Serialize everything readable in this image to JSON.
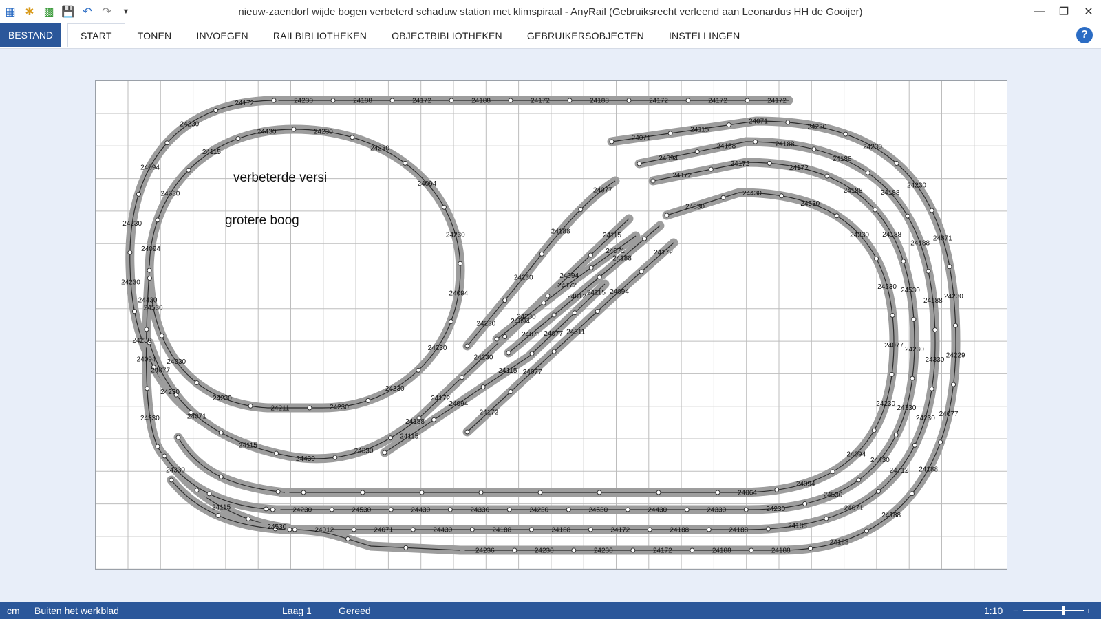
{
  "window": {
    "title": "nieuw-zaendorf wijde bogen verbeterd schaduw station met klimspiraal -  AnyRail (Gebruiksrecht verleend aan Leonardus HH de Gooijer)",
    "minimize_icon": "minimize-icon",
    "restore_icon": "restore-icon",
    "close_icon": "close-icon"
  },
  "quick_access": {
    "icons": [
      "app-logo-icon",
      "new-file-icon",
      "open-file-icon",
      "save-icon",
      "undo-icon",
      "redo-icon",
      "customize-dropdown-icon"
    ]
  },
  "ribbon": {
    "file_tab": "BESTAND",
    "tabs": [
      "START",
      "TONEN",
      "INVOEGEN",
      "RAILBIBLIOTHEKEN",
      "OBJECTBIBLIOTHEKEN",
      "GEBRUIKERSOBJECTEN",
      "INSTELLINGEN"
    ],
    "active_tab": "START",
    "help_label": "?"
  },
  "layout": {
    "annotations": [
      "verbeterde versi",
      "grotere boog"
    ],
    "track_labels": [
      "24230",
      "24188",
      "24172",
      "24188",
      "24172",
      "24188",
      "24172",
      "24172",
      "24172",
      "24172",
      "24230",
      "24094",
      "24230",
      "24230",
      "24230",
      "24230",
      "24230",
      "24230",
      "24094",
      "24230",
      "24094",
      "24230",
      "24230",
      "24230",
      "24211",
      "24230",
      "24230",
      "24530",
      "24094",
      "24530",
      "24115",
      "24430",
      "24430",
      "24094",
      "24330",
      "24330",
      "24115",
      "24530",
      "24077",
      "24071",
      "24115",
      "24430",
      "24330",
      "24188",
      "24172",
      "24230",
      "24230",
      "24094",
      "24115",
      "24230",
      "24230",
      "24188",
      "24077",
      "24094",
      "24172",
      "24071",
      "24071",
      "24612",
      "24188",
      "24172",
      "24077",
      "24611",
      "24094",
      "24172",
      "24115",
      "24094",
      "24115",
      "24077",
      "24115",
      "24071",
      "24115",
      "24071",
      "24230",
      "24230",
      "24230",
      "24671",
      "24230",
      "24229",
      "24077",
      "24188",
      "24188",
      "24188",
      "24188",
      "24188",
      "24172",
      "24230",
      "24230",
      "24236",
      "24094",
      "24188",
      "24188",
      "24188",
      "24188",
      "24188",
      "24188",
      "24330",
      "24230",
      "24712",
      "24071",
      "24188",
      "24188",
      "24188",
      "24172",
      "24188",
      "24188",
      "24430",
      "24071",
      "24912",
      "24172",
      "24172",
      "24172",
      "24188",
      "24188",
      "24530",
      "24230",
      "24330",
      "24430",
      "24530",
      "24230",
      "24330",
      "24430",
      "24530",
      "24230",
      "24330",
      "24430",
      "24530",
      "24230",
      "24330",
      "24430",
      "24530",
      "24230",
      "24230",
      "24077",
      "24230",
      "24094",
      "24094",
      "24064"
    ]
  },
  "statusbar": {
    "unit": "cm",
    "position": "Buiten het werkblad",
    "layer": "Laag 1",
    "state": "Gereed",
    "scale": "1:10",
    "zoom_minus": "−",
    "zoom_plus": "+"
  }
}
